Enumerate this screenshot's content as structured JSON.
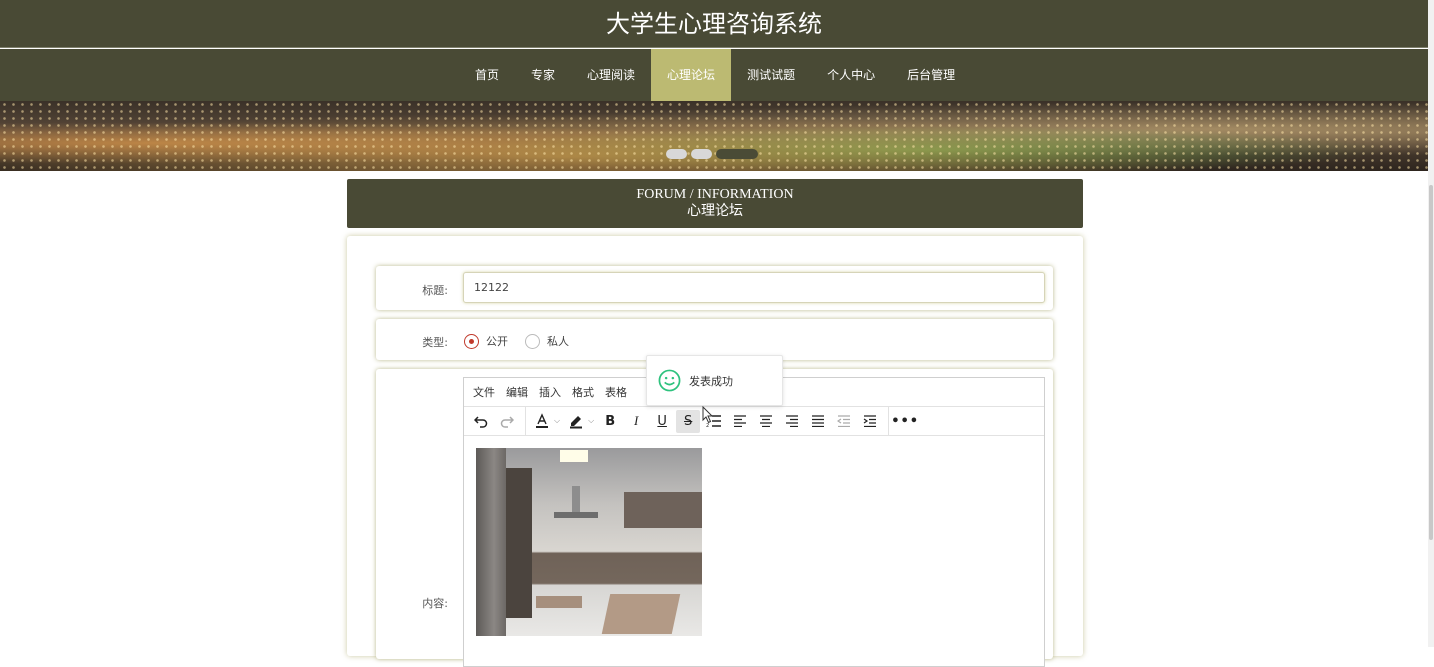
{
  "header": {
    "title": "大学生心理咨询系统"
  },
  "nav": {
    "items": [
      {
        "label": "首页",
        "active": false
      },
      {
        "label": "专家",
        "active": false
      },
      {
        "label": "心理阅读",
        "active": false
      },
      {
        "label": "心理论坛",
        "active": true
      },
      {
        "label": "测试试题",
        "active": false
      },
      {
        "label": "个人中心",
        "active": false
      },
      {
        "label": "后台管理",
        "active": false
      }
    ]
  },
  "section": {
    "title_en": "FORUM / INFORMATION",
    "title_cn": "心理论坛"
  },
  "form": {
    "title_label": "标题:",
    "title_value": "12122",
    "type_label": "类型:",
    "type_options": [
      {
        "label": "公开",
        "checked": true
      },
      {
        "label": "私人",
        "checked": false
      }
    ],
    "content_label": "内容:"
  },
  "editor": {
    "menu": [
      "文件",
      "编辑",
      "插入",
      "格式",
      "表格"
    ],
    "toolbar_icons": [
      "undo-icon",
      "redo-icon",
      "text-color-icon",
      "highlight-color-icon",
      "bold-icon",
      "italic-icon",
      "underline-icon",
      "strikethrough-icon",
      "numbered-list-icon",
      "align-left-icon",
      "align-center-icon",
      "align-right-icon",
      "justify-icon",
      "outdent-icon",
      "indent-icon",
      "more-icon"
    ],
    "image_alt": "kitchen-photo"
  },
  "toast": {
    "message": "发表成功",
    "icon": "smile-icon"
  },
  "colors": {
    "primary": "#494a35",
    "accent": "#bcba72",
    "radio": "#c0392b",
    "toast_icon": "#2ec27e"
  }
}
